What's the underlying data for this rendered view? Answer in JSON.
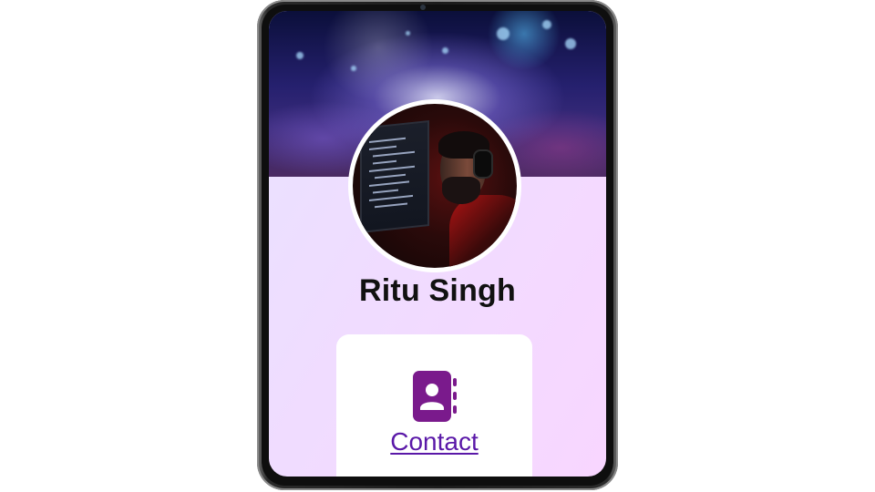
{
  "profile": {
    "name": "Ritu Singh"
  },
  "contact_card": {
    "icon": "contact-book-icon",
    "link_label": "Contact"
  },
  "colors": {
    "accent": "#7a1a8c",
    "link": "#5a18a8",
    "screen_background": "#f0dcff"
  }
}
